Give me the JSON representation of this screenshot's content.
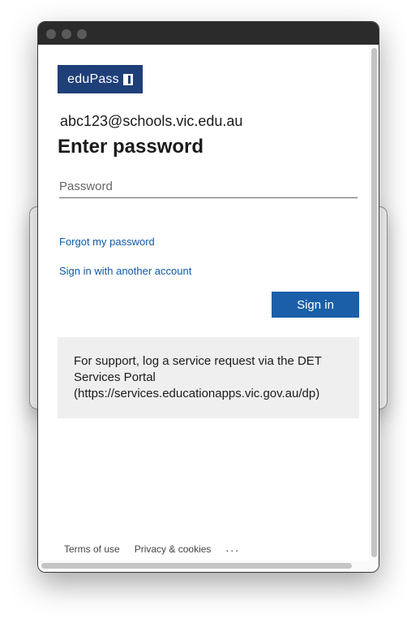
{
  "brand": {
    "logo_text": "eduPass",
    "color": "#1e3f78"
  },
  "account": {
    "identity": "abc123@schools.vic.edu.au"
  },
  "form": {
    "title": "Enter password",
    "password_placeholder": "Password",
    "password_value": "",
    "forgot_link": "Forgot my password",
    "other_account_link": "Sign in with another account",
    "signin_label": "Sign in",
    "button_color": "#1a5fa8",
    "link_color": "#0f5aa8"
  },
  "support": {
    "text": "For support, log a service request via the DET Services Portal (https://services.educationapps.vic.gov.au/dp)"
  },
  "footer": {
    "terms": "Terms of use",
    "privacy": "Privacy & cookies",
    "more": "..."
  }
}
